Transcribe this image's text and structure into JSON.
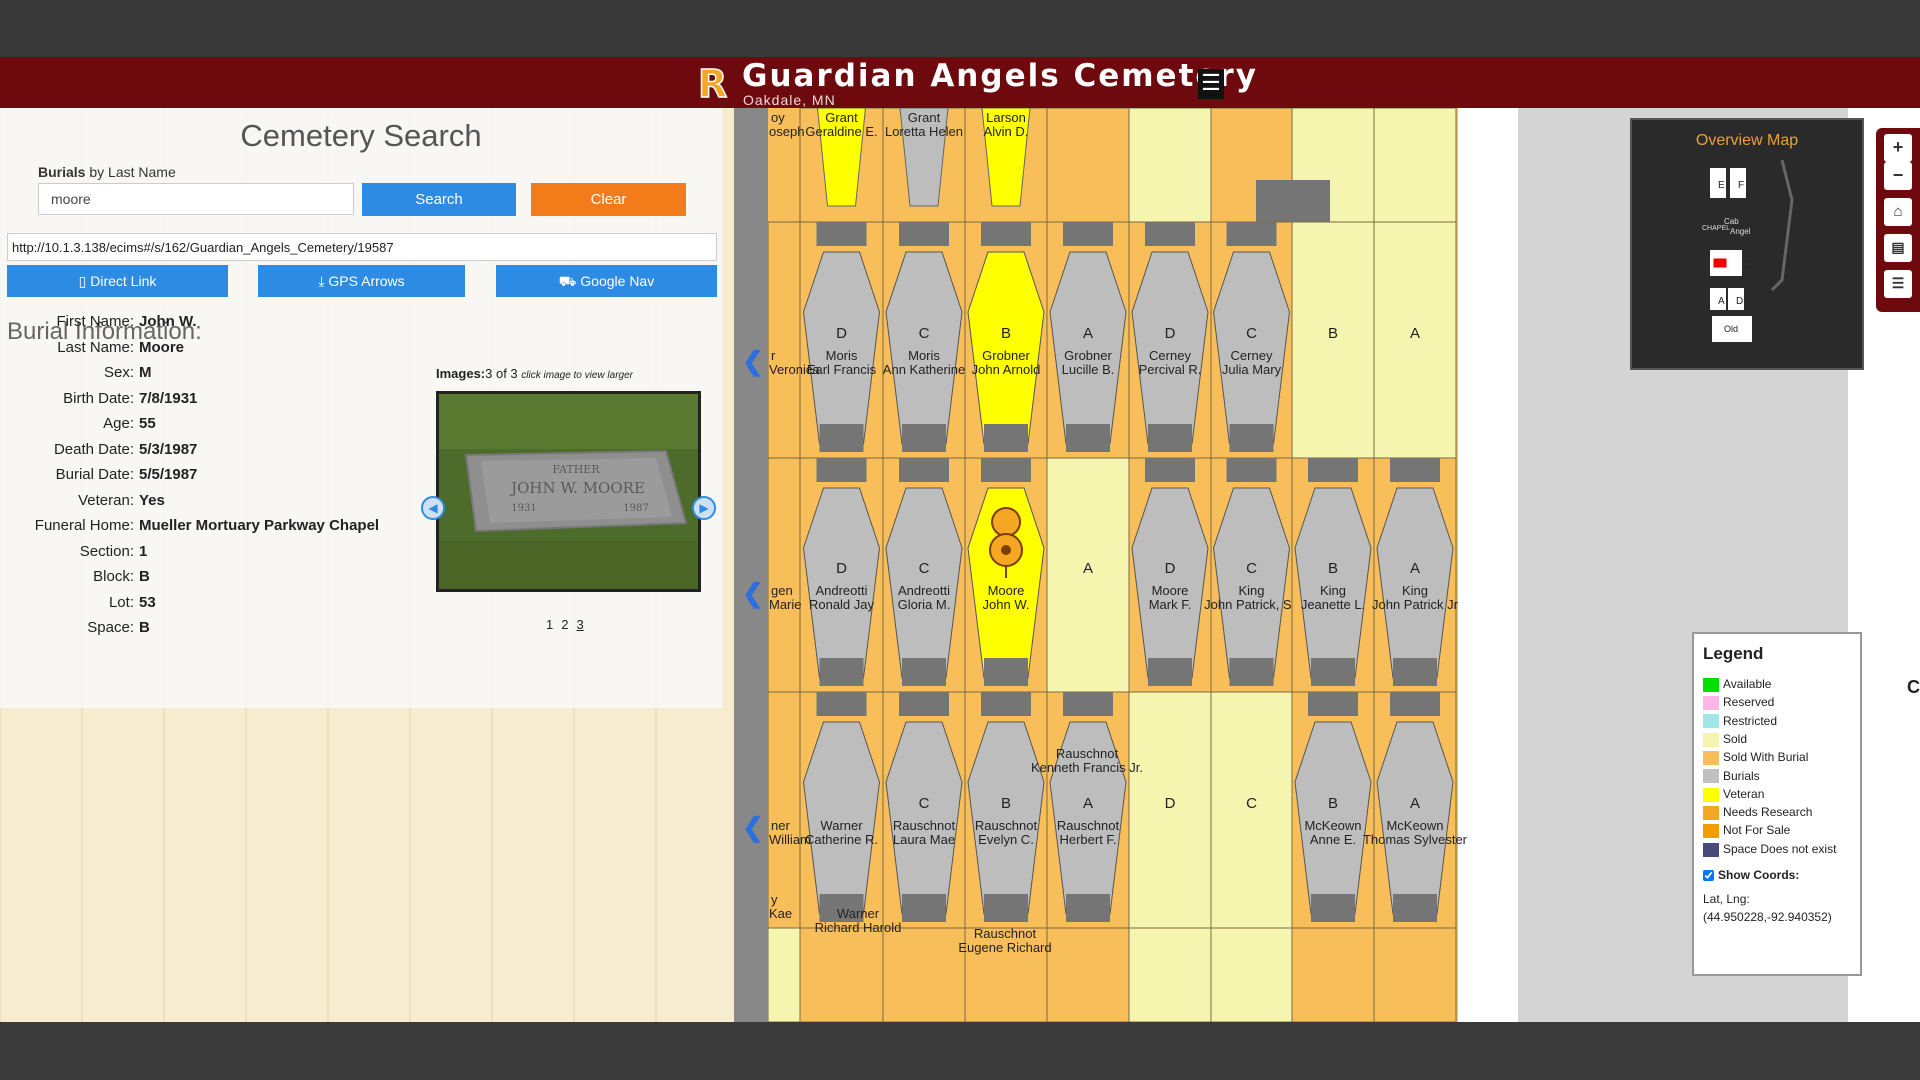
{
  "header": {
    "title": "Guardian Angels Cemetery",
    "subtitle": "Oakdale, MN",
    "logo_letter": "R"
  },
  "search": {
    "title": "Cemetery Search",
    "label_bold": "Burials",
    "label_rest": " by Last Name",
    "value": "moore",
    "search_label": "Search",
    "clear_label": "Clear",
    "url": "http://10.1.3.138/ecims#/s/162/Guardian_Angels_Cemetery/19587"
  },
  "actions": {
    "direct_link": "Direct Link",
    "gps_arrows": "GPS Arrows",
    "google_nav": "Google Nav"
  },
  "burial": {
    "title": "Burial Information:",
    "fields": [
      {
        "label": "First Name:",
        "value": "John W."
      },
      {
        "label": "Last Name:",
        "value": "Moore"
      },
      {
        "label": "Sex:",
        "value": "M"
      },
      {
        "label": "Birth Date:",
        "value": "7/8/1931"
      },
      {
        "label": "Age:",
        "value": "55"
      },
      {
        "label": "Death Date:",
        "value": "5/3/1987"
      },
      {
        "label": "Burial Date:",
        "value": "5/5/1987"
      },
      {
        "label": "Veteran:",
        "value": "Yes"
      },
      {
        "label": "Funeral Home:",
        "value": "Mueller Mortuary Parkway Chapel"
      },
      {
        "label": "Section:",
        "value": "1"
      },
      {
        "label": "Block:",
        "value": "B"
      },
      {
        "label": "Lot:",
        "value": "53"
      },
      {
        "label": "Space:",
        "value": "B"
      }
    ]
  },
  "images": {
    "label": "Images:",
    "count": "3 of 3",
    "hint": "click image to view larger",
    "pages": [
      "1",
      "2",
      "3"
    ],
    "current_page": "3",
    "headstone_line1": "FATHER",
    "headstone_line2": "JOHN W. MOORE",
    "headstone_year1": "1931",
    "headstone_year2": "1987"
  },
  "overview": {
    "title": "Overview Map",
    "labels": [
      "E",
      "F",
      "C",
      "A",
      "D",
      "Old"
    ],
    "misc_labels": [
      "Cab",
      "Angel",
      "CHAPEL"
    ]
  },
  "map_controls": {
    "zoom_in": "+",
    "zoom_out": "−"
  },
  "legend": {
    "title": "Legend",
    "items": [
      {
        "label": "Available",
        "color": "#00e000"
      },
      {
        "label": "Reserved",
        "color": "#ffb6e6"
      },
      {
        "label": "Restricted",
        "color": "#9fe6e6"
      },
      {
        "label": "Sold",
        "color": "#f5f5b0"
      },
      {
        "label": "Sold With Burial",
        "color": "#f7be5a"
      },
      {
        "label": "Burials",
        "color": "#c0c0c0"
      },
      {
        "label": "Veteran",
        "color": "#ffff00"
      },
      {
        "label": "Needs Research",
        "color": "#f5a623"
      },
      {
        "label": "Not For Sale",
        "color": "#f59b00"
      },
      {
        "label": "Space Does not exist",
        "color": "#4a4a7a"
      }
    ],
    "show_coords_label": "Show Coords:",
    "coords_label": "Lat, Lng:",
    "coords_value": "(44.950228,-92.940352)"
  },
  "map": {
    "edge_letter": "C",
    "top_row": [
      {
        "fam": "Grant",
        "name": "Geraldine E.",
        "type": "veteran"
      },
      {
        "fam": "Grant",
        "name": "Loretta Helen",
        "type": "burial"
      },
      {
        "fam": "Larson",
        "name": "Alvin D.",
        "type": "veteran"
      }
    ],
    "top_row_partial": {
      "fam": "oy",
      "name": "oseph"
    },
    "row1": [
      {
        "space": "D",
        "fam": "Moris",
        "name": "Earl Francis",
        "type": "burial"
      },
      {
        "space": "C",
        "fam": "Moris",
        "name": "Ann Katherine",
        "type": "burial"
      },
      {
        "space": "B",
        "fam": "Grobner",
        "name": "John Arnold",
        "type": "veteran"
      },
      {
        "space": "A",
        "fam": "Grobner",
        "name": "Lucille B.",
        "type": "burial"
      },
      {
        "space": "D",
        "fam": "Cerney",
        "name": "Percival R.",
        "type": "burial"
      },
      {
        "space": "C",
        "fam": "Cerney",
        "name": "Julia Mary",
        "type": "burial"
      },
      {
        "space": "B",
        "fam": "",
        "name": "",
        "type": "sold"
      },
      {
        "space": "A",
        "fam": "",
        "name": "",
        "type": "sold"
      }
    ],
    "row1_partial": {
      "fam": "r",
      "name": "Veronica"
    },
    "row2": [
      {
        "space": "D",
        "fam": "Andreotti",
        "name": "Ronald Jay",
        "type": "burial"
      },
      {
        "space": "C",
        "fam": "Andreotti",
        "name": "Gloria M.",
        "type": "burial"
      },
      {
        "space": "",
        "fam": "Moore",
        "name": "John W.",
        "type": "veteran"
      },
      {
        "space": "A",
        "fam": "",
        "name": "",
        "type": "sold"
      },
      {
        "space": "D",
        "fam": "Moore",
        "name": "Mark F.",
        "type": "burial"
      },
      {
        "space": "C",
        "fam": "King",
        "name": "John Patrick, Sr.",
        "type": "burial"
      },
      {
        "space": "B",
        "fam": "King",
        "name": "Jeanette L.",
        "type": "burial"
      },
      {
        "space": "A",
        "fam": "King",
        "name": "John Patrick Jr",
        "type": "burial"
      }
    ],
    "row2_partial": {
      "fam": "gen",
      "name": "Marie"
    },
    "row3": [
      {
        "space": "",
        "fam": "Warner",
        "name": "Catherine R.",
        "type": "burial"
      },
      {
        "space": "C",
        "fam": "Rauschnot",
        "name": "Laura Mae",
        "type": "burial"
      },
      {
        "space": "B",
        "fam": "Rauschnot",
        "name": "Evelyn C.",
        "type": "burial"
      },
      {
        "space": "A",
        "fam": "Rauschnot",
        "name": "Herbert F.",
        "type": "burial"
      },
      {
        "space": "D",
        "fam": "",
        "name": "",
        "type": "sold"
      },
      {
        "space": "C",
        "fam": "",
        "name": "",
        "type": "sold"
      },
      {
        "space": "B",
        "fam": "McKeown",
        "name": "Anne E.",
        "type": "burial"
      },
      {
        "space": "A",
        "fam": "McKeown",
        "name": "Thomas Sylvester",
        "type": "burial"
      }
    ],
    "row3_partial": {
      "fam": "ner",
      "name": "William"
    },
    "row3_extra": [
      {
        "fam": "Rauschnot",
        "name": "Kenneth Francis Jr."
      },
      {
        "fam": "Warner",
        "name": "Richard Harold"
      },
      {
        "fam": "Rauschnot",
        "name": "Eugene Richard"
      }
    ],
    "row3_extra_partial": {
      "fam": "y",
      "name": "Kae"
    }
  }
}
